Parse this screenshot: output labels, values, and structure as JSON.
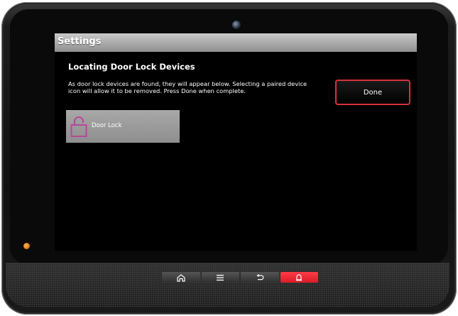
{
  "screen": {
    "title": "Settings",
    "heading": "Locating Door Lock Devices",
    "description_line1": "As door lock devices are found, they will appear below.  Selecting a paired device",
    "description_line2": "icon will allow it to be removed.  Press Done when complete.",
    "done_label": "Done",
    "devices": [
      {
        "label": "Door Lock",
        "icon": "padlock-open-icon"
      }
    ]
  },
  "hardware": {
    "buttons": [
      {
        "icon": "home-icon"
      },
      {
        "icon": "menu-icon"
      },
      {
        "icon": "back-icon"
      },
      {
        "icon": "alarm-icon"
      }
    ]
  },
  "colors": {
    "done_border": "#d8333a",
    "lock_icon": "#b8479c",
    "alarm_button": "#e8232f",
    "status_led": "#d97a17"
  }
}
